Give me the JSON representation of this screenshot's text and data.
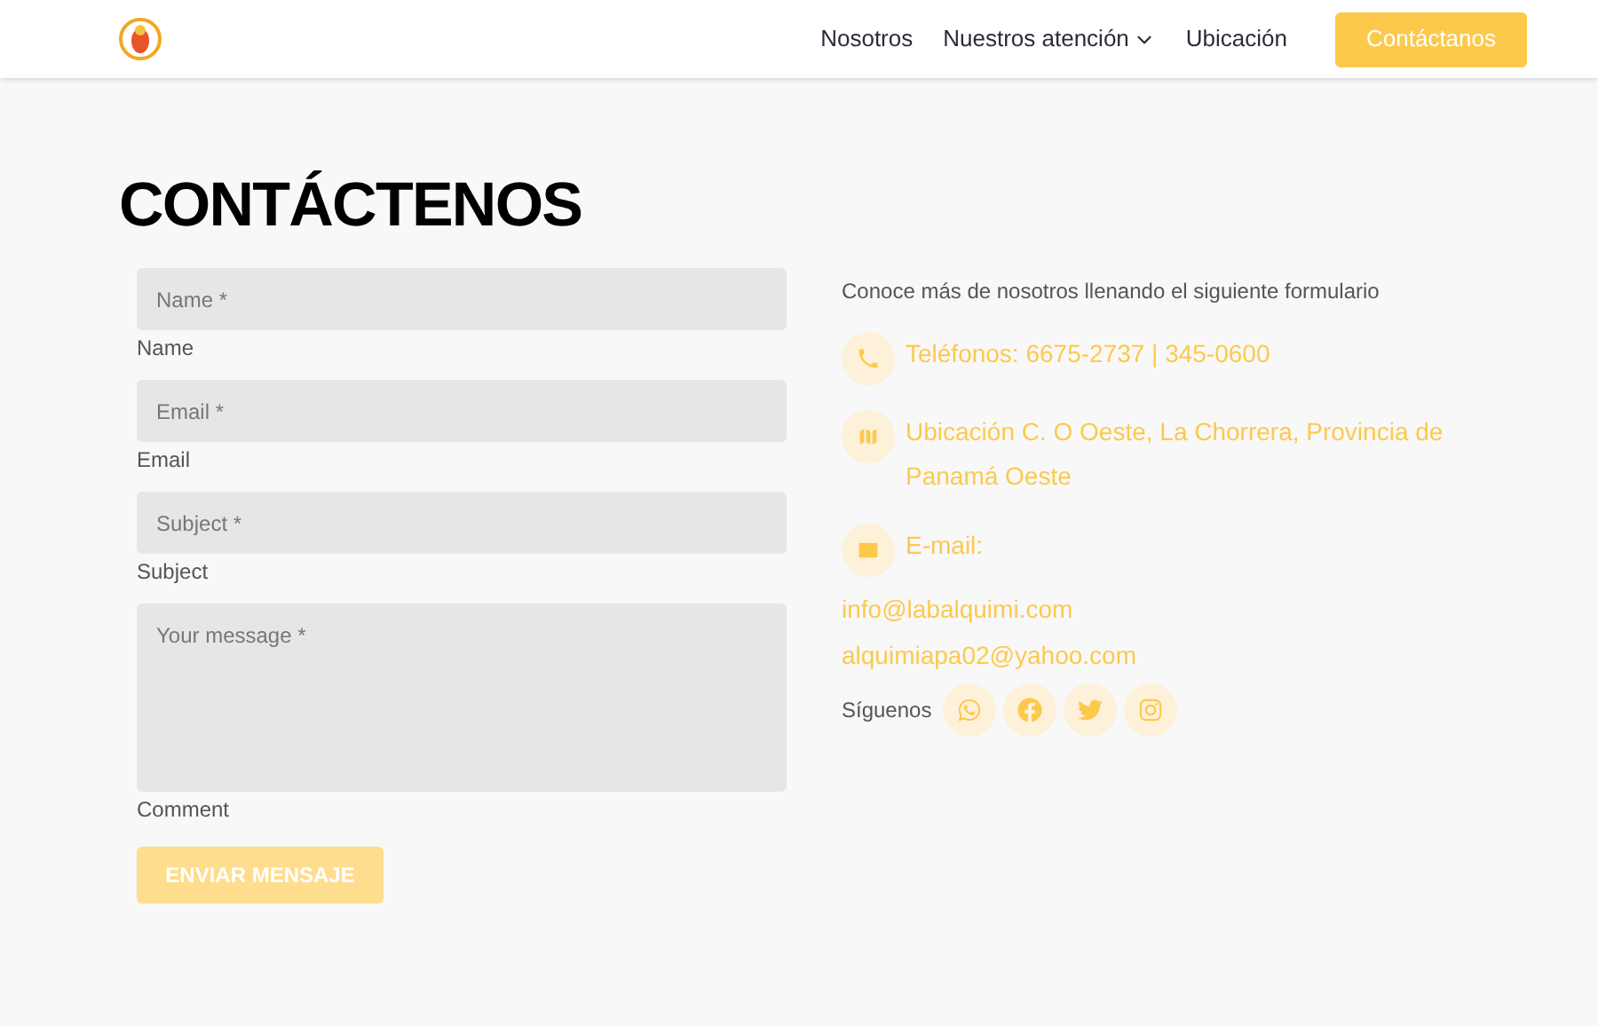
{
  "nav": {
    "links": [
      {
        "label": "Nosotros",
        "dropdown": false
      },
      {
        "label": "Nuestros atención",
        "dropdown": true
      },
      {
        "label": "Ubicación",
        "dropdown": false
      }
    ],
    "cta": "Contáctanos"
  },
  "heading": "CONTÁCTENOS",
  "form": {
    "fields": [
      {
        "kind": "input",
        "placeholder": "Name *",
        "label": "Name"
      },
      {
        "kind": "input",
        "placeholder": "Email *",
        "label": "Email"
      },
      {
        "kind": "input",
        "placeholder": "Subject *",
        "label": "Subject"
      },
      {
        "kind": "textarea",
        "placeholder": "Your message *",
        "label": "Comment"
      }
    ],
    "submit": {
      "label": "ENVIAR MENSAJE",
      "disabled": true
    }
  },
  "contact": {
    "intro": "Conoce más de nosotros llenando el siguiente formulario",
    "items": [
      {
        "kind": "phone",
        "text": "Teléfonos: 6675-2737 | 345-0600"
      },
      {
        "kind": "location",
        "text": "Ubicación C. O Oeste, La Chorrera, Provincia de Panamá Oeste"
      },
      {
        "kind": "email",
        "text": "E-mail:"
      }
    ],
    "emails": [
      "info@labalquimi.com",
      "alquimiapa02@yahoo.com"
    ],
    "follow_label": "Síguenos",
    "social": [
      {
        "kind": "whatsapp"
      },
      {
        "kind": "facebook"
      },
      {
        "kind": "twitter"
      },
      {
        "kind": "instagram"
      }
    ]
  }
}
